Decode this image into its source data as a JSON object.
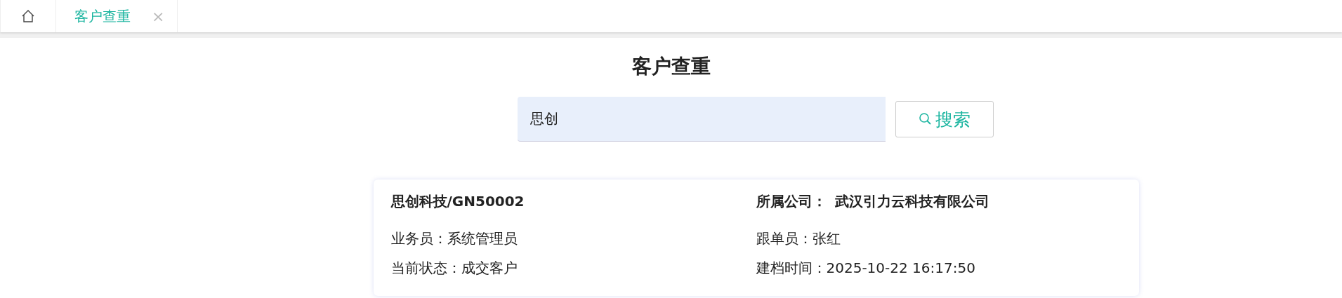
{
  "tabs": [
    {
      "kind": "home",
      "selected": false
    },
    {
      "kind": "page",
      "label": "客户查重",
      "close": "×",
      "selected": true
    }
  ],
  "page": {
    "title": "客户查重"
  },
  "search": {
    "value": "思创",
    "button": "搜索"
  },
  "results": [
    {
      "name": "思创科技/GN50002",
      "company_label": "所属公司：",
      "company": "武汉引力云科技有限公司",
      "fields": [
        "业务员：系统管理员",
        "跟单员：张红",
        "当前状态：成交客户",
        "建档时间：2025-10-22 16:17:50"
      ]
    }
  ]
}
